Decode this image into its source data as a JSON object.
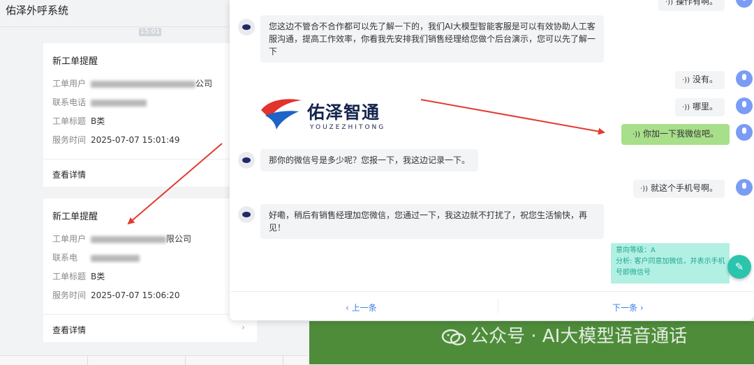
{
  "app": {
    "title": "佑泽外呼系统"
  },
  "left": {
    "time_chip": "15:01",
    "cards": [
      {
        "title": "新工单提醒",
        "user_label": "工单用户",
        "user_tail": "公司",
        "phone_label": "联系电话",
        "subject_label": "工单标题",
        "subject_value": "B类",
        "time_label": "服务时间",
        "time_value": "2025-07-07 15:01:49",
        "detail_label": "查看详情"
      },
      {
        "title": "新工单提醒",
        "user_label": "工单用户",
        "user_tail": "限公司",
        "phone_label": "联系电",
        "subject_label": "工单标题",
        "subject_value": "B类",
        "time_label": "服务时间",
        "time_value": "2025-07-07 15:06:20",
        "detail_label": "查看详情"
      }
    ]
  },
  "chat": {
    "messages": [
      {
        "side": "right",
        "text": "操作有啊。"
      },
      {
        "side": "left",
        "text": "您这边不管合不合作都可以先了解一下的，我们AI大模型智能客服是可以有效协助人工客服沟通，提高工作效率，你看我先安排我们销售经理给您做个后台演示，您可以先了解一下"
      },
      {
        "side": "right",
        "text": "没有。"
      },
      {
        "side": "right",
        "text": "哪里。"
      },
      {
        "side": "right",
        "text": "你加一下我微信吧。",
        "highlight": true
      },
      {
        "side": "left",
        "text": "那你的微信号是多少呢？您报一下，我这边记录一下。"
      },
      {
        "side": "right",
        "text": "就这个手机号啊。"
      },
      {
        "side": "left",
        "text": "好嘞，稍后有销售经理加您微信，您通过一下，我这边就不打扰了，祝您生活愉快，再见！"
      }
    ],
    "analysis": {
      "intent": "意向等级：A",
      "detail": "分析: 客户同意加微信，并表示手机号即微信号"
    },
    "prev_label": "上一条",
    "next_label": "下一条"
  },
  "logo": {
    "cn": "佑泽智通",
    "en": "YOUZEZHITONG"
  },
  "watermark": "公众号 · AI大模型语音通话",
  "colors": {
    "accent": "#3a7fe8",
    "highlight_bubble": "#a8df8a",
    "analysis_bg": "#b3f0e4",
    "fab": "#2bc4ad",
    "arrow": "#e03b2e"
  }
}
